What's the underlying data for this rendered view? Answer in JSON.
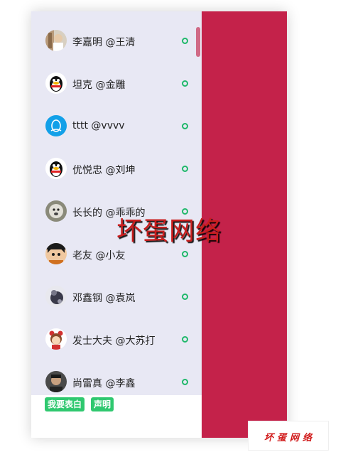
{
  "contacts": [
    {
      "name": "李嘉明 @王清",
      "avatar": "photo-avatar-icon"
    },
    {
      "name": "坦克 @金雕",
      "avatar": "qq-penguin-icon"
    },
    {
      "name": "tttt @vvvv",
      "avatar": "qq-default-icon"
    },
    {
      "name": "优悦忠 @刘坤",
      "avatar": "qq-penguin-icon"
    },
    {
      "name": "长长的 @乖乖的",
      "avatar": "dog-photo-icon"
    },
    {
      "name": "老友 @小友",
      "avatar": "cartoon-face-icon"
    },
    {
      "name": "邓鑫钢 @袁岚",
      "avatar": "dark-photo-icon"
    },
    {
      "name": "发士大夫 @大苏打",
      "avatar": "girl-cartoon-icon"
    },
    {
      "name": "尚雷真 @李鑫",
      "avatar": "man-photo-icon"
    }
  ],
  "footer": {
    "confess_label": "我要表白",
    "statement_label": "声明"
  },
  "watermark": {
    "center_text": "坏蛋网络",
    "corner_text": "坏蛋网络"
  },
  "colors": {
    "list_bg": "#e8e8f4",
    "side_panel": "#c4224a",
    "status_online": "#1fb86a",
    "button_green": "#2fc86f"
  }
}
